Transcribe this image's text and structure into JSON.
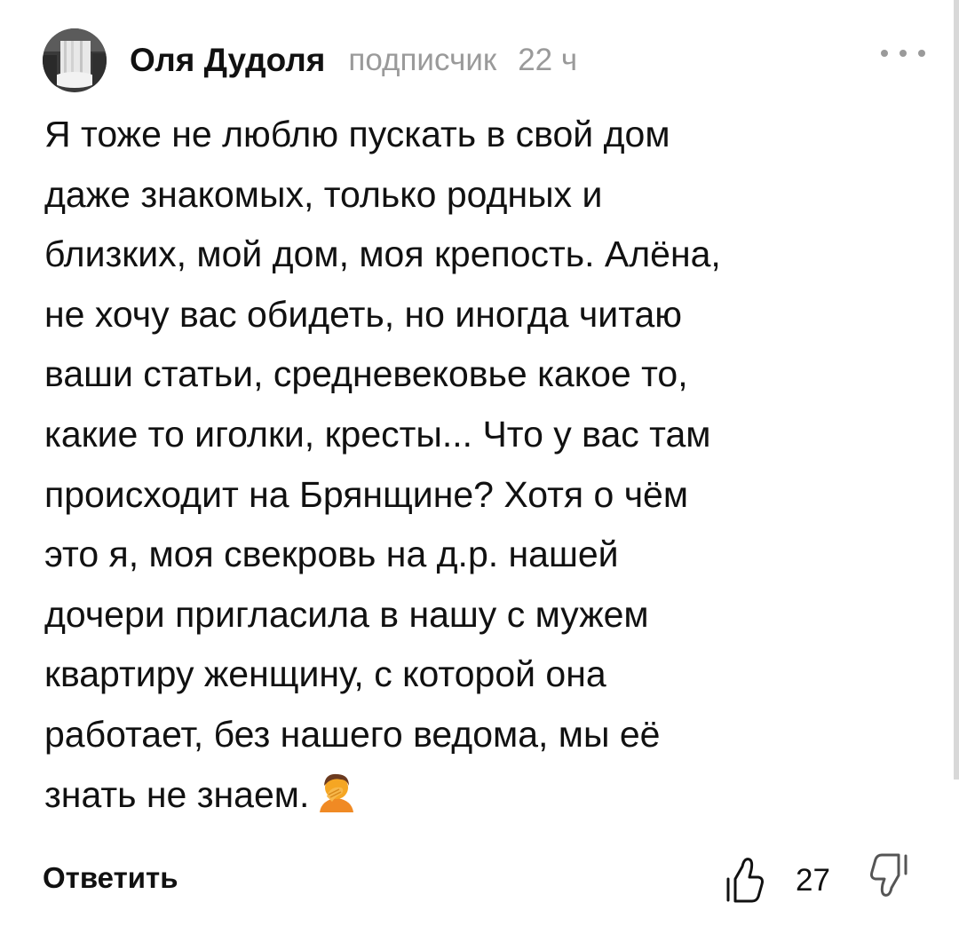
{
  "comment": {
    "author": "Оля Дудоля",
    "role": "подписчик",
    "time": "22 ч",
    "text": "Я тоже не люблю пускать в свой дом\nдаже знакомых, только родных и\nблизких, мой дом, моя крепость. Алёна,\nне хочу вас обидеть, но иногда читаю\nваши статьи, средневековье какое то,\nкакие то иголки, кресты... Что у вас там\nпроисходит на Брянщине? Хотя о чём\nэто я, моя свекровь на д.р. нашей\nдочери пригласила в нашу с мужем\nквартиру женщину, с которой она\nработает, без нашего ведома, мы её\nзнать не знаем.",
    "trailing_emoji": "facepalm-emoji"
  },
  "actions": {
    "more_icon": "more-horizontal-icon",
    "reply_label": "Ответить",
    "like_icon": "thumbs-up-icon",
    "like_count": "27",
    "dislike_icon": "thumbs-down-icon"
  },
  "colors": {
    "text": "#111111",
    "muted": "#9a9a9a",
    "emoji_skin": "#f5a623",
    "emoji_hair": "#6b3a1f"
  }
}
